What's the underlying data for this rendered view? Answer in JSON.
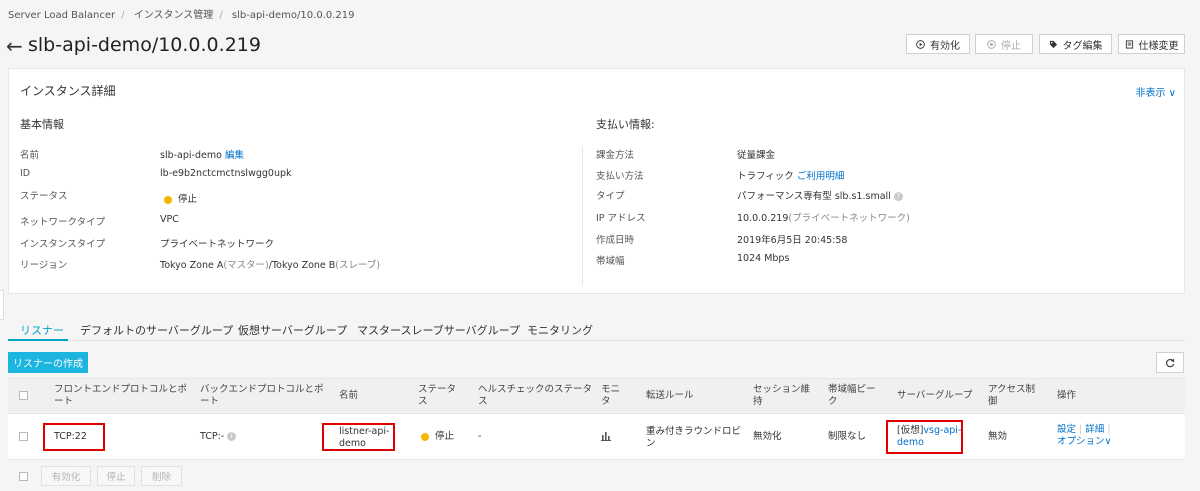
{
  "breadcrumb": [
    "Server Load Balancer",
    "インスタンス管理",
    "slb-api-demo/10.0.0.219"
  ],
  "page_title": "slb-api-demo/10.0.0.219",
  "toolbar": {
    "enable": "有効化",
    "stop": "停止",
    "tag_edit": "タグ編集",
    "spec_change": "仕様変更"
  },
  "detail": {
    "title": "インスタンス詳細",
    "hide": "非表示",
    "basic_title": "基本情報",
    "payment_title": "支払い情報:",
    "basic": {
      "name_label": "名前",
      "name_value": "slb-api-demo",
      "edit": "編集",
      "id_label": "ID",
      "id_value": "lb-e9b2nctcmctnslwgg0upk",
      "status_label": "ステータス",
      "status_value": "停止",
      "nettype_label": "ネットワークタイプ",
      "nettype_value": "VPC",
      "insttype_label": "インスタンスタイプ",
      "insttype_value": "プライベートネットワーク",
      "region_label": "リージョン",
      "region_value": "Tokyo Zone A",
      "region_master": "(マスター)",
      "region_sep": "/Tokyo Zone B",
      "region_slave": "(スレーブ)"
    },
    "payment": {
      "billing_label": "課金方法",
      "billing_value": "従量課金",
      "paymethod_label": "支払い方法",
      "paymethod_value": "トラフィック",
      "usage_link": "ご利用明細",
      "type_label": "タイプ",
      "type_value": "パフォーマンス専有型",
      "type_spec": "slb.s1.small",
      "ip_label": "IP アドレス",
      "ip_value": "10.0.0.219",
      "ip_note": "(プライベートネットワーク)",
      "created_label": "作成日時",
      "created_value": "2019年6月5日 20:45:58",
      "bw_label": "帯域幅",
      "bw_value": "1024 Mbps"
    }
  },
  "tabs": [
    "リスナー",
    "デフォルトのサーバーグループ",
    "仮想サーバーグループ",
    "マスタースレーブサーバグループ",
    "モニタリング"
  ],
  "create_listener": "リスナーの作成",
  "table": {
    "headers": {
      "frontend1": "フロントエンドプロトコルとポ",
      "frontend2": "ート",
      "backend1": "バックエンドプロトコルとポ",
      "backend2": "ート",
      "name": "名前",
      "status1": "ステータ",
      "status2": "ス",
      "health1": "ヘルスチェックのステータ",
      "health2": "ス",
      "monitor1": "モニ",
      "monitor2": "タ",
      "rule": "転送ルール",
      "session1": "セッション維",
      "session2": "持",
      "bwpeak1": "帯域幅ピー",
      "bwpeak2": "ク",
      "group": "サーバーグループ",
      "access1": "アクセス制",
      "access2": "御",
      "ops": "操作"
    },
    "row": {
      "frontend": "TCP:22",
      "backend": "TCP:-",
      "name1": "listner-api-",
      "name2": "demo",
      "status": "停止",
      "health": "-",
      "rule1": "重み付きラウンドロビ",
      "rule2": "ン",
      "session": "無効化",
      "bwpeak": "制限なし",
      "group_prefix": "[仮想]",
      "group_link1": "vsg-api-",
      "group_link2": "demo",
      "access": "無効",
      "op_settings": "設定",
      "op_detail": "詳細",
      "op_options": "オプション"
    }
  },
  "bulk": {
    "enable": "有効化",
    "stop": "停止",
    "delete": "削除"
  }
}
